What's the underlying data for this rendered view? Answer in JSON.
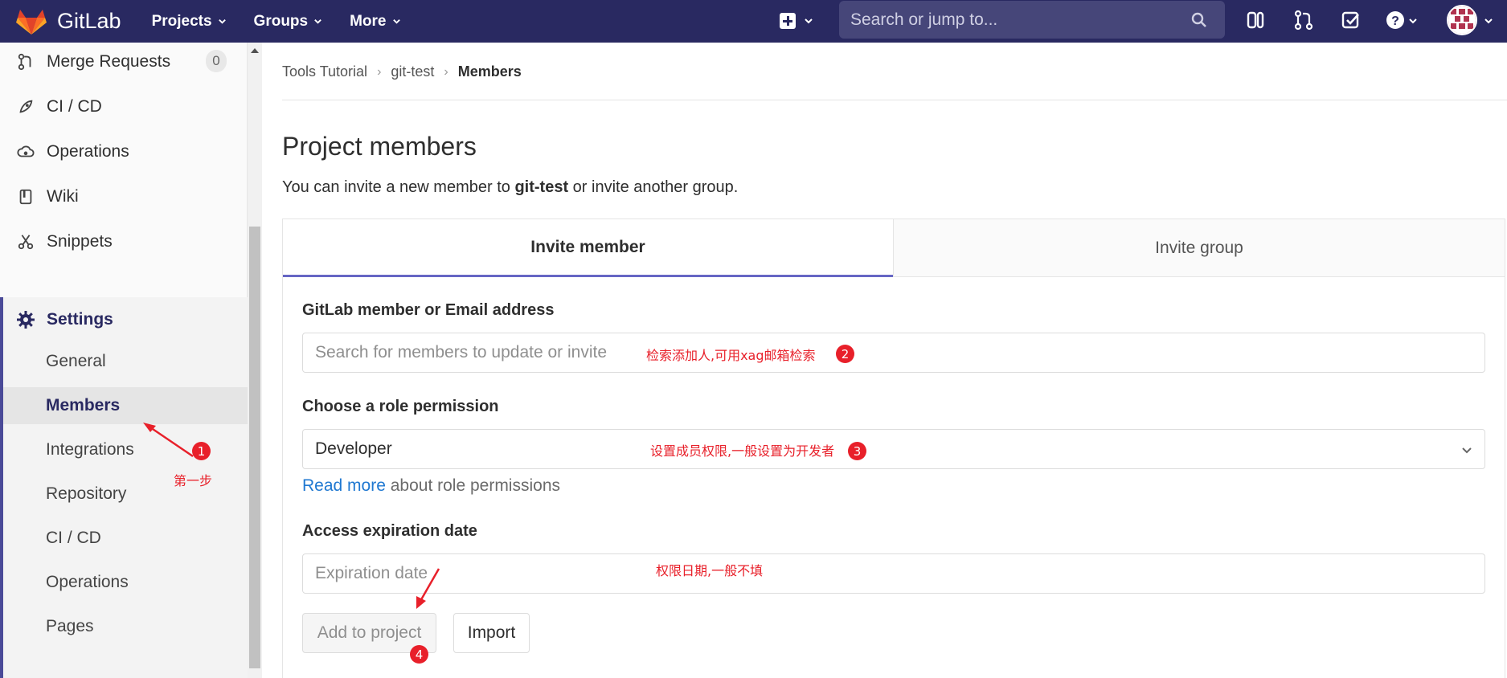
{
  "navbar": {
    "brand": "GitLab",
    "menus": [
      "Projects",
      "Groups",
      "More"
    ],
    "search_placeholder": "Search or jump to..."
  },
  "sidebar": {
    "merge_requests": {
      "label": "Merge Requests",
      "count": "0"
    },
    "items": [
      "CI / CD",
      "Operations",
      "Wiki",
      "Snippets"
    ],
    "settings": {
      "label": "Settings",
      "children": [
        "General",
        "Members",
        "Integrations",
        "Repository",
        "CI / CD",
        "Operations",
        "Pages"
      ]
    }
  },
  "breadcrumb": [
    "Tools Tutorial",
    "git-test",
    "Members"
  ],
  "main": {
    "title": "Project members",
    "intro_prefix": "You can invite a new member to ",
    "intro_project": "git-test",
    "intro_suffix": " or invite another group.",
    "tabs": [
      "Invite member",
      "Invite group"
    ],
    "member_label": "GitLab member or Email address",
    "member_placeholder": "Search for members to update or invite",
    "role_label": "Choose a role permission",
    "role_value": "Developer",
    "read_more_link": "Read more",
    "read_more_suffix": " about role permissions",
    "expiration_label": "Access expiration date",
    "expiration_placeholder": "Expiration date",
    "add_button": "Add to project",
    "import_button": "Import"
  },
  "annotations": {
    "step1_label": "第一步",
    "step1_num": "1",
    "member_note": "检索添加人,可用xag邮箱检索",
    "member_num": "2",
    "role_note": "设置成员权限,一般设置为开发者",
    "role_num": "3",
    "expiry_note": "权限日期,一般不填",
    "add_num": "4"
  },
  "colors": {
    "navbar_bg": "#292961",
    "accent": "#6666c4",
    "link": "#1f78d1",
    "annotation": "#e8202a"
  }
}
